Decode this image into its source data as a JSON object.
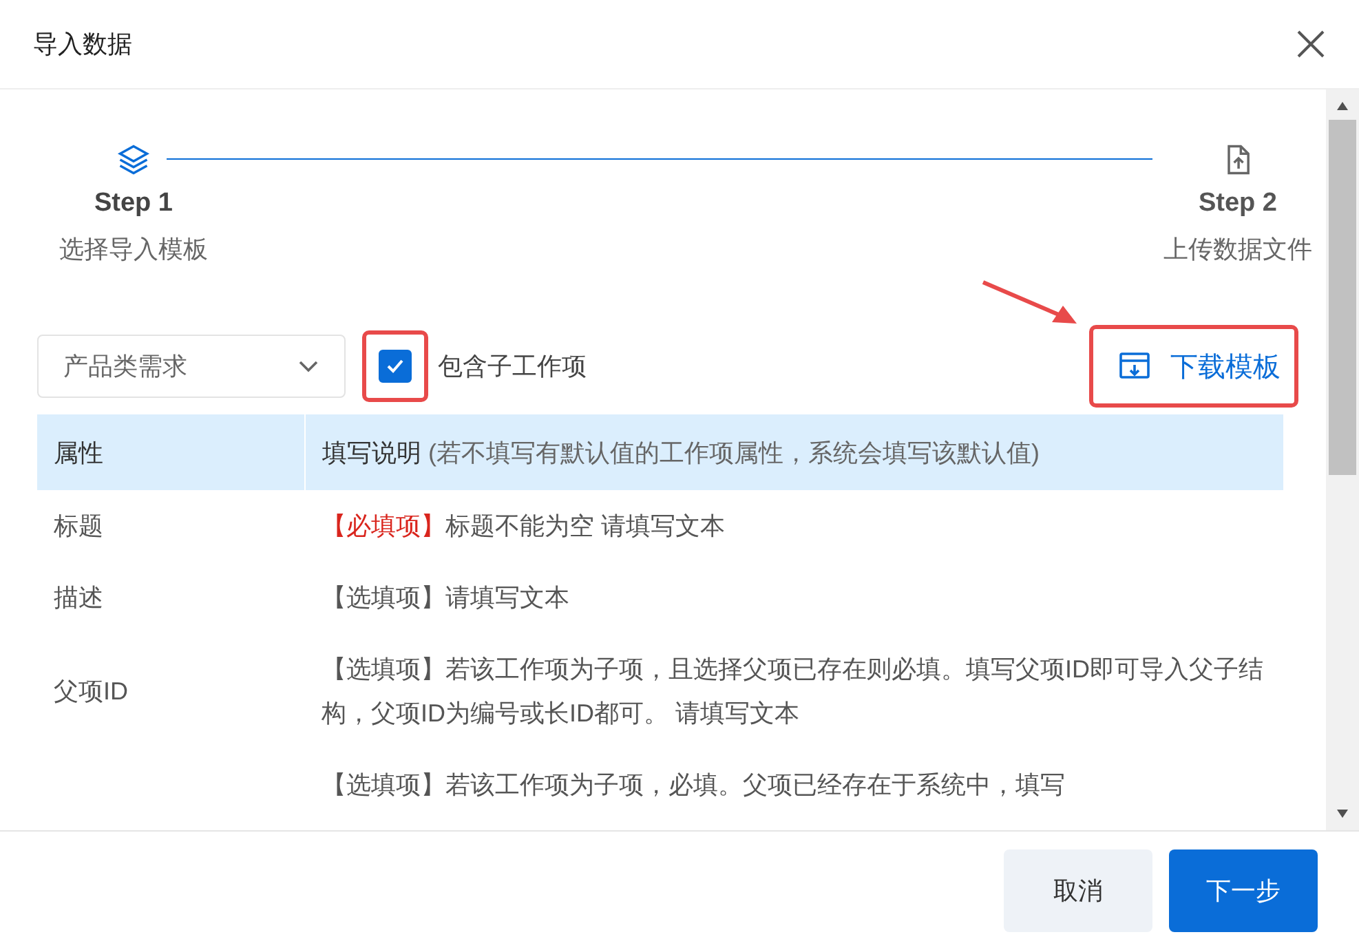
{
  "dialog": {
    "title": "导入数据"
  },
  "steps": [
    {
      "label": "Step 1",
      "description": "选择导入模板",
      "selected": true,
      "kind": "layers"
    },
    {
      "label": "Step 2",
      "description": "上传数据文件",
      "selected": false,
      "kind": "file-upload"
    }
  ],
  "toolbar": {
    "select": {
      "value": "产品类需求"
    },
    "include_children": {
      "label": "包含子工作项",
      "checked": true
    },
    "download_button": {
      "label": "下载模板"
    }
  },
  "table": {
    "columns": [
      {
        "label": "属性"
      },
      {
        "label": "填写说明",
        "note": "(若不填写有默认值的工作项属性，系统会填写该默认值)"
      }
    ],
    "rows": [
      {
        "attribute": "标题",
        "tag": "【必填项】",
        "required": true,
        "text": "标题不能为空 请填写文本"
      },
      {
        "attribute": "描述",
        "tag": "【选填项】",
        "required": false,
        "text": "请填写文本"
      },
      {
        "attribute": "父项ID",
        "tag": "【选填项】",
        "required": false,
        "text": "若该工作项为子项，且选择父项已存在则必填。填写父项ID即可导入父子结构，父项ID为编号或长ID都可。 请填写文本"
      },
      {
        "tag": "【选填项】",
        "required": false,
        "text": "若该工作项为子项，必填。父项已经存在于系统中，填写"
      }
    ]
  },
  "buttons": [
    {
      "label": "取消",
      "kind": "secondary"
    },
    {
      "label": "下一步",
      "kind": "primary"
    }
  ]
}
